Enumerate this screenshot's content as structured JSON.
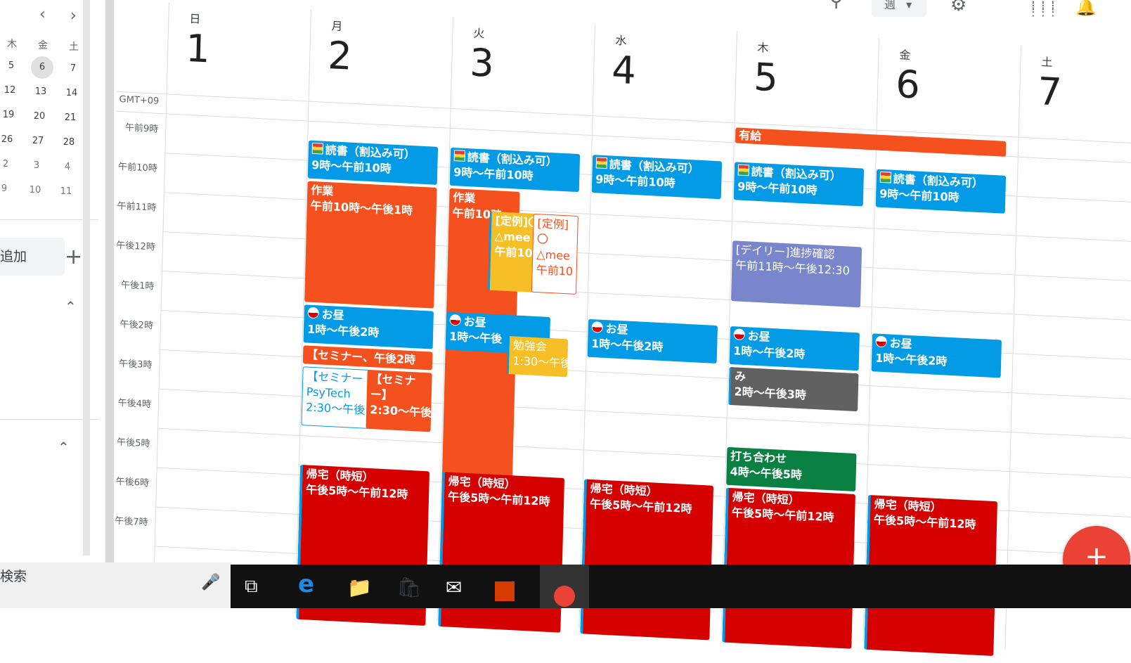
{
  "mini_calendar": {
    "prev_label": "‹",
    "next_label": "›",
    "headers": [
      "木",
      "金",
      "土"
    ],
    "rows": [
      [
        "5",
        "6",
        "7"
      ],
      [
        "12",
        "13",
        "14"
      ],
      [
        "19",
        "20",
        "21"
      ],
      [
        "26",
        "27",
        "28"
      ],
      [
        "2",
        "3",
        "4"
      ],
      [
        "9",
        "10",
        "11"
      ]
    ]
  },
  "sidebar": {
    "add_label": "追加",
    "plus": "+",
    "chevron_up": "⌃"
  },
  "toolbar": {
    "view_label": "週",
    "view_caret": "▾",
    "search_icon": "⚲",
    "settings_icon": "⚙",
    "apps_icon": "⋮⋮⋮",
    "bell_icon": "🔔"
  },
  "timezone": "GMT+09",
  "days": [
    {
      "name": "日",
      "num": "1"
    },
    {
      "name": "月",
      "num": "2"
    },
    {
      "name": "火",
      "num": "3"
    },
    {
      "name": "水",
      "num": "4"
    },
    {
      "name": "木",
      "num": "5"
    },
    {
      "name": "金",
      "num": "6"
    },
    {
      "name": "土",
      "num": "7"
    }
  ],
  "times": [
    "午前9時",
    "午前10時",
    "午前11時",
    "午後12時",
    "午後1時",
    "午後2時",
    "午後3時",
    "午後4時",
    "午後5時",
    "午後6時",
    "午後7時"
  ],
  "allday": {
    "title": "有給"
  },
  "events": {
    "mon_read": {
      "title": "読書（割込み可）",
      "time": "9時〜午前10時"
    },
    "mon_work": {
      "title": "作業",
      "time": "午前10時〜午後1時"
    },
    "mon_lunch": {
      "title": "お昼",
      "time": "1時〜午後2時"
    },
    "mon_seminar1": {
      "title": "【セミナー、午後2時"
    },
    "mon_seminar2": {
      "title": "【セミナー",
      "subtitle": "PsyTech",
      "time": "2:30〜午後"
    },
    "mon_seminar3": {
      "title": "【セミナ",
      "subtitle": "ー】",
      "time": "2:30〜午後"
    },
    "mon_home": {
      "title": "帰宅（時短）",
      "time": "午後5時〜午前12時"
    },
    "tue_read": {
      "title": "読書（割込み可）",
      "time": "9時〜午前10時"
    },
    "tue_work": {
      "title": "作業",
      "time": "午前10時"
    },
    "tue_teirei1": {
      "title": "[定例]〇",
      "subtitle": "△mee",
      "time": "午前10"
    },
    "tue_teirei2": {
      "title": "[定例]",
      "subtitle": "〇",
      "line3": "△mee",
      "time": "午前10"
    },
    "tue_lunch": {
      "title": "お昼",
      "time": "1時〜午後"
    },
    "tue_study": {
      "title": "勉強会",
      "time": "1:30〜午後"
    },
    "tue_home": {
      "title": "帰宅（時短）",
      "time": "午後5時〜午前12時"
    },
    "wed_read": {
      "title": "読書（割込み可）",
      "time": "9時〜午前10時"
    },
    "wed_lunch": {
      "title": "お昼",
      "time": "1時〜午後2時"
    },
    "wed_home": {
      "title": "帰宅（時短）",
      "time": "午後5時〜午前12時"
    },
    "thu_read": {
      "title": "読書（割込み可）",
      "time": "9時〜午前10時"
    },
    "thu_daily": {
      "title": "[デイリー]進捗確認",
      "time": "午前11時〜午後12:30"
    },
    "thu_lunch": {
      "title": "お昼",
      "time": "1時〜午後2時"
    },
    "thu_mi": {
      "title": "み",
      "time": "2時〜午後3時"
    },
    "thu_meeting": {
      "title": "打ち合わせ",
      "time": "4時〜午後5時"
    },
    "thu_home": {
      "title": "帰宅（時短）",
      "time": "午後5時〜午前12時"
    },
    "fri_read": {
      "title": "読書（割込み可）",
      "time": "9時〜午前10時"
    },
    "fri_lunch": {
      "title": "お昼",
      "time": "1時〜午後2時"
    },
    "fri_home": {
      "title": "帰宅（時短）",
      "time": "午後5時〜午前12時"
    }
  },
  "fab_label": "+",
  "taskbar": {
    "search_label": "検索",
    "mic_icon": "🎤",
    "task_view_icon": "⧉",
    "edge_icon": "e",
    "explorer_icon": "📁",
    "store_icon": "🛍",
    "mail_icon": "✉"
  }
}
